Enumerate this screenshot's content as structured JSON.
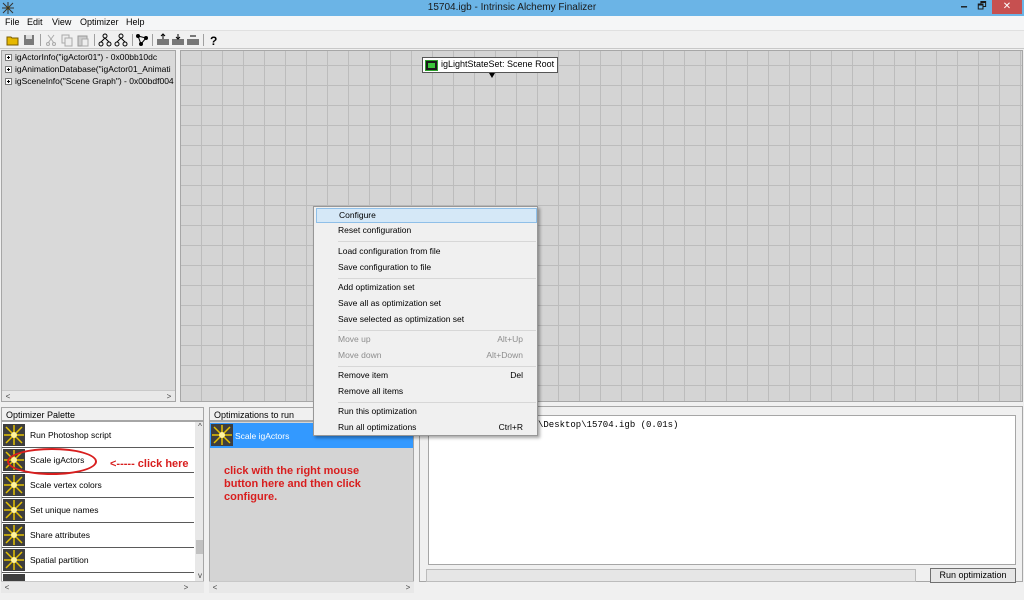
{
  "window": {
    "title": "15704.igb - Intrinsic Alchemy Finalizer",
    "minimize": "🗕",
    "maximize": "🗗",
    "close": "✕"
  },
  "menu": [
    "File",
    "Edit",
    "View",
    "Optimizer",
    "Help"
  ],
  "toolbar": {
    "icons": [
      "open-icon",
      "save-icon",
      "cut-icon",
      "copy-icon",
      "paste-icon",
      "tree-icon",
      "tree-alt-icon",
      "graph-icon",
      "export-icon",
      "import-icon",
      "export-alt-icon",
      "help-icon"
    ]
  },
  "tree": {
    "items": [
      "igActorInfo(\"igActor01\") - 0x00bb10dc",
      "igAnimationDatabase(\"igActor01_Animati",
      "igSceneInfo(\"Scene Graph\") - 0x00bdf004"
    ]
  },
  "graph": {
    "node_label": "igLightStateSet: Scene Root"
  },
  "palette": {
    "header": "Optimizer Palette",
    "items": [
      "Run Photoshop script",
      "Scale igActors",
      "Scale vertex colors",
      "Set unique names",
      "Share attributes",
      "Spatial partition"
    ]
  },
  "optimizations": {
    "header": "Optimizations to run",
    "items": [
      "Scale igActors"
    ]
  },
  "output": {
    "text": "\\Desktop\\15704.igb (0.01s)",
    "run_button": "Run optimization"
  },
  "annotation": {
    "arrow": "<----- click here",
    "instruction": "click with the right mouse button here and then click configure."
  },
  "context_menu": {
    "items": [
      {
        "label": "Configure",
        "shortcut": "",
        "disabled": false,
        "highlighted": true
      },
      {
        "label": "Reset configuration",
        "shortcut": "",
        "disabled": false
      },
      {
        "label": "Load configuration from file",
        "shortcut": "",
        "disabled": false
      },
      {
        "label": "Save configuration to file",
        "shortcut": "",
        "disabled": false
      },
      {
        "label": "Add optimization set",
        "shortcut": "",
        "disabled": false
      },
      {
        "label": "Save all as optimization set",
        "shortcut": "",
        "disabled": false
      },
      {
        "label": "Save selected as optimization set",
        "shortcut": "",
        "disabled": false
      },
      {
        "label": "Move up",
        "shortcut": "Alt+Up",
        "disabled": true
      },
      {
        "label": "Move down",
        "shortcut": "Alt+Down",
        "disabled": true
      },
      {
        "label": "Remove item",
        "shortcut": "Del",
        "disabled": false
      },
      {
        "label": "Remove all items",
        "shortcut": "",
        "disabled": false
      },
      {
        "label": "Run this optimization",
        "shortcut": "",
        "disabled": false
      },
      {
        "label": "Run all optimizations",
        "shortcut": "Ctrl+R",
        "disabled": false
      }
    ]
  },
  "colors": {
    "titlebar": "#6bb4e6",
    "selection": "#3399ff",
    "annotation": "#d81e1e",
    "menu_highlight": "#d5e8f7"
  }
}
